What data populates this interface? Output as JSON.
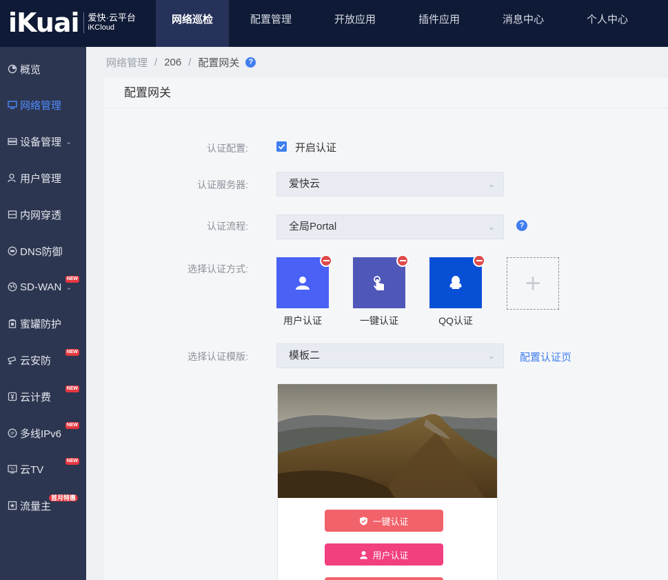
{
  "brand": {
    "logo": "iKuai",
    "name_cn": "爱快·云平台",
    "name_en": "iKCloud"
  },
  "top_nav": [
    {
      "label": "网络巡检",
      "active": true
    },
    {
      "label": "配置管理",
      "active": false
    },
    {
      "label": "开放应用",
      "active": false
    },
    {
      "label": "插件应用",
      "active": false
    },
    {
      "label": "消息中心",
      "active": false
    },
    {
      "label": "个人中心",
      "active": false
    }
  ],
  "sidebar": {
    "items": [
      {
        "label": "概览",
        "icon": "dashboard-icon"
      },
      {
        "label": "网络管理",
        "icon": "monitor-icon",
        "active": true
      },
      {
        "label": "设备管理",
        "icon": "server-icon",
        "expandable": true
      },
      {
        "label": "用户管理",
        "icon": "user-icon"
      },
      {
        "label": "内网穿透",
        "icon": "tunnel-icon"
      },
      {
        "label": "DNS防御",
        "icon": "dns-shield-icon"
      },
      {
        "label": "SD-WAN",
        "icon": "globe-icon",
        "expandable": true,
        "badge": "NEW"
      },
      {
        "label": "蜜罐防护",
        "icon": "honeypot-icon"
      },
      {
        "label": "云安防",
        "icon": "camera-icon",
        "badge": "NEW"
      },
      {
        "label": "云计费",
        "icon": "billing-icon",
        "badge": "NEW"
      },
      {
        "label": "多线IPv6",
        "icon": "ipv6-icon",
        "badge": "NEW"
      },
      {
        "label": "云TV",
        "icon": "tv-icon",
        "badge": "NEW"
      },
      {
        "label": "流量主",
        "icon": "star-icon",
        "badge": "首月特惠"
      }
    ]
  },
  "breadcrumb": {
    "root": "网络管理",
    "sep": "/",
    "device": "206",
    "current": "配置网关",
    "help": "?"
  },
  "panel": {
    "title": "配置网关"
  },
  "form": {
    "auth_config": {
      "label": "认证配置:",
      "checkbox_label": "开启认证",
      "checked": true
    },
    "auth_server": {
      "label": "认证服务器:",
      "value": "爱快云"
    },
    "auth_flow": {
      "label": "认证流程:",
      "value": "全局Portal",
      "help": "?"
    },
    "auth_methods": {
      "label": "选择认证方式:",
      "items": [
        {
          "name": "用户认证",
          "color": "#4a61f5",
          "icon": "user-icon"
        },
        {
          "name": "一键认证",
          "color": "#4f58b8",
          "icon": "tap-icon"
        },
        {
          "name": "QQ认证",
          "color": "#0750d6",
          "icon": "qq-icon"
        }
      ],
      "add": "+"
    },
    "auth_template": {
      "label": "选择认证模版:",
      "value": "模板二",
      "link": "配置认证页"
    }
  },
  "preview": {
    "buttons": [
      {
        "label": "一键认证",
        "color": "#f2626a",
        "icon": "shield-check-icon"
      },
      {
        "label": "用户认证",
        "color": "#f13f7f",
        "icon": "user-icon"
      },
      {
        "label": "",
        "color": "#f2626a"
      }
    ]
  },
  "colors": {
    "topbar": "#0f1a36",
    "sidebar": "#2d3650",
    "accent": "#3f7ef0",
    "badge": "#e5373f"
  }
}
